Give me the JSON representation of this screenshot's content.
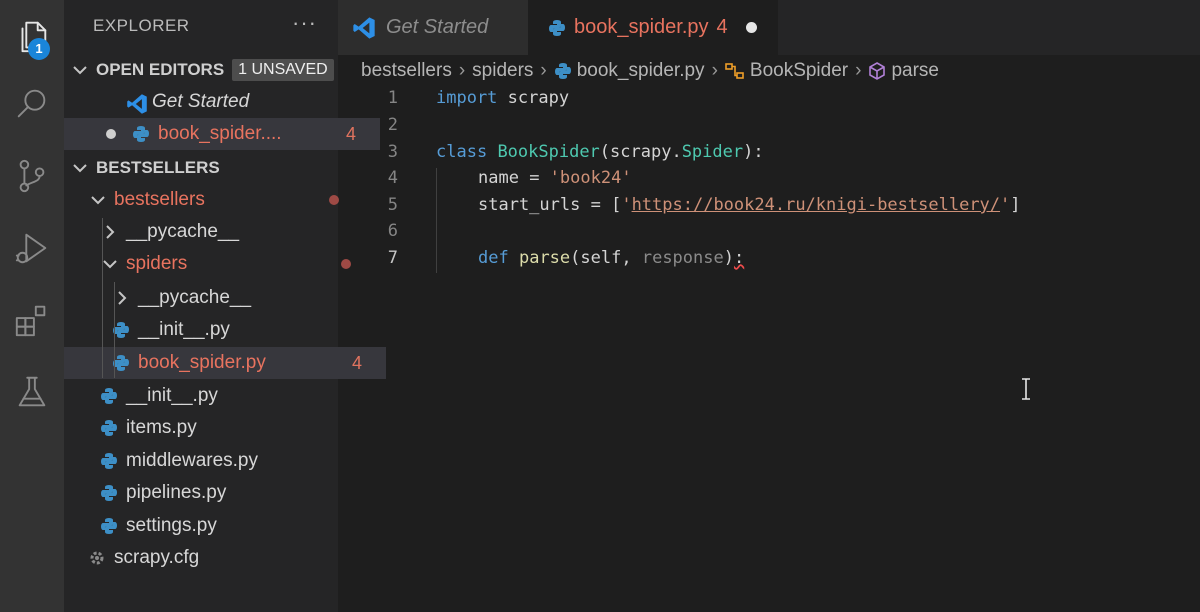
{
  "activity_bar": {
    "explorer_badge": "1",
    "icons": [
      "files-icon",
      "search-icon",
      "source-control-icon",
      "run-debug-icon",
      "extensions-icon",
      "testing-icon"
    ]
  },
  "sidebar": {
    "title": "EXPLORER",
    "more": "···",
    "open_editors": {
      "label": "OPEN EDITORS",
      "badge": "1 UNSAVED",
      "items": [
        {
          "name": "Get Started"
        },
        {
          "name": "book_spider....",
          "problems": "4"
        }
      ]
    },
    "project": {
      "label": "BESTSELLERS",
      "tree": [
        {
          "name": "bestsellers"
        },
        {
          "name": "__pycache__"
        },
        {
          "name": "spiders"
        },
        {
          "name": "__pycache__"
        },
        {
          "name": "__init__.py"
        },
        {
          "name": "book_spider.py",
          "problems": "4"
        },
        {
          "name": "__init__.py"
        },
        {
          "name": "items.py"
        },
        {
          "name": "middlewares.py"
        },
        {
          "name": "pipelines.py"
        },
        {
          "name": "settings.py"
        },
        {
          "name": "scrapy.cfg"
        }
      ]
    }
  },
  "tabs": [
    {
      "label": "Get Started"
    },
    {
      "label": "book_spider.py",
      "problems": "4"
    }
  ],
  "breadcrumb": [
    "bestsellers",
    "spiders",
    "book_spider.py",
    "BookSpider",
    "parse"
  ],
  "editor": {
    "line_numbers": [
      "1",
      "2",
      "3",
      "4",
      "5",
      "6",
      "7"
    ],
    "lines": {
      "l1": {
        "kw": "import",
        "rest": " scrapy"
      },
      "l3": {
        "kw": "class",
        "cls": "BookSpider",
        "open": "(scrapy.",
        "base": "Spider",
        "close": "):"
      },
      "l4": {
        "var": "name",
        "eq": " = ",
        "str": "'book24'"
      },
      "l5": {
        "var": "start_urls",
        "eq": " = [",
        "q1": "'",
        "url": "https://book24.ru/knigi-bestsellery/",
        "q2": "'",
        "end": "]"
      },
      "l7": {
        "kw": "def",
        "fn": "parse",
        "open": "(",
        "self": "self",
        "comma": ", ",
        "param": "response",
        "close": ")",
        "colon": ":"
      }
    }
  },
  "colors": {
    "accent_badge": "#1a85d9",
    "modified_file": "#e8735f",
    "keyword": "#569cd6",
    "string": "#ce9178"
  }
}
